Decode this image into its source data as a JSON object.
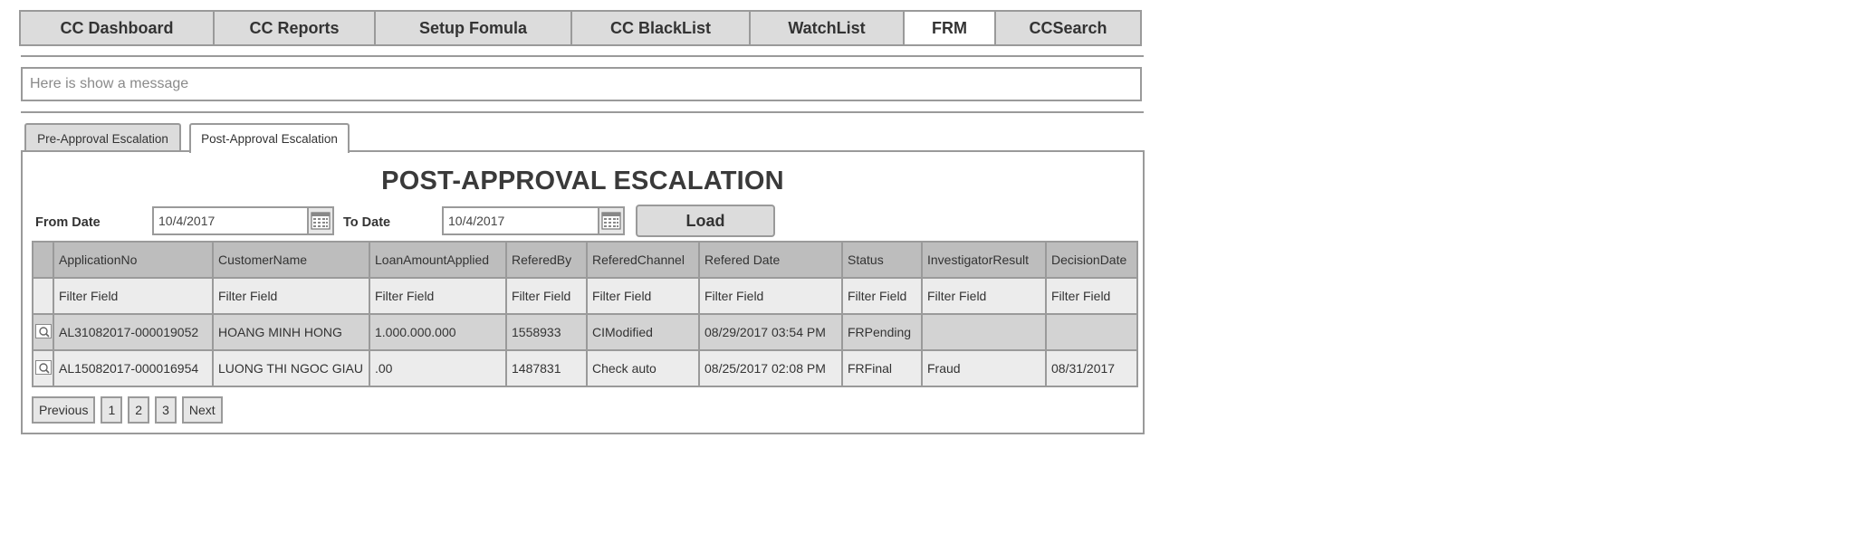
{
  "nav": {
    "tabs": [
      {
        "label": "CC Dashboard",
        "active": false
      },
      {
        "label": "CC Reports",
        "active": false
      },
      {
        "label": "Setup Fomula",
        "active": false
      },
      {
        "label": "CC BlackList",
        "active": false
      },
      {
        "label": "WatchList",
        "active": false
      },
      {
        "label": "FRM",
        "active": true
      },
      {
        "label": "CCSearch",
        "active": false
      }
    ]
  },
  "message": {
    "text": "Here is show a message"
  },
  "subtabs": [
    {
      "label": "Pre-Approval Escalation",
      "active": false
    },
    {
      "label": "Post-Approval Escalation",
      "active": true
    }
  ],
  "panel": {
    "title": "POST-APPROVAL ESCALATION",
    "from_label": "From Date",
    "from_value": "10/4/2017",
    "to_label": "To Date",
    "to_value": "10/4/2017",
    "load_label": "Load"
  },
  "table": {
    "columns": [
      "",
      "ApplicationNo",
      "CustomerName",
      "LoanAmountApplied",
      "ReferedBy",
      "ReferedChannel",
      "Refered Date",
      "Status",
      "InvestigatorResult",
      "DecisionDate"
    ],
    "filters": [
      "",
      "Filter Field",
      "Filter Field",
      "Filter Field",
      "Filter Field",
      "Filter Field",
      "Filter Field",
      "Filter Field",
      "Filter Field",
      "Filter Field"
    ],
    "rows": [
      [
        "",
        "AL31082017-000019052",
        "HOANG MINH HONG",
        "1.000.000.000",
        "1558933",
        "CIModified",
        "08/29/2017 03:54 PM",
        "FRPending",
        "",
        ""
      ],
      [
        "",
        "AL15082017-000016954",
        "LUONG THI NGOC GIAU",
        ".00",
        "1487831",
        "Check auto",
        "08/25/2017 02:08 PM",
        "FRFinal",
        "Fraud",
        "08/31/2017"
      ]
    ]
  },
  "pagination": {
    "previous": "Previous",
    "pages": [
      "1",
      "2",
      "3"
    ],
    "next": "Next"
  },
  "icons": {
    "calendar": "calendar-icon",
    "row_select": "magnifier-icon"
  },
  "colors": {
    "border": "#9a9a9a",
    "header_bg": "#bdbdbd",
    "tab_bg": "#dcdcdc",
    "active_tab_bg": "#ffffff"
  }
}
